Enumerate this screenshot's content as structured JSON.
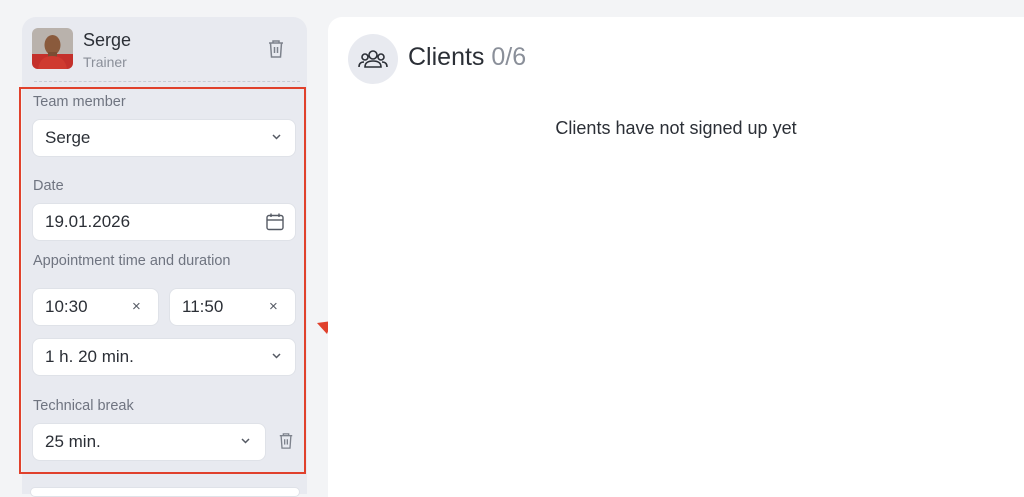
{
  "staff": {
    "name": "Serge",
    "role": "Trainer"
  },
  "form": {
    "team_member_label": "Team member",
    "team_member_value": "Serge",
    "date_label": "Date",
    "date_value": "19.01.2026",
    "time_label": "Appointment time and duration",
    "start_time": "10:30",
    "end_time": "11:50",
    "clear_symbol": "×",
    "duration_value": "1 h. 20 min.",
    "break_label": "Technical break",
    "break_value": "25 min."
  },
  "clients": {
    "title": "Clients",
    "count": "0/6",
    "empty_message": "Clients have not signed up yet"
  },
  "colors": {
    "highlight": "#e0412c",
    "panel": "#e8eaf0"
  },
  "icons": [
    "trash-icon",
    "calendar-icon",
    "chevron-down-icon",
    "clear-icon",
    "clients-group-icon"
  ]
}
